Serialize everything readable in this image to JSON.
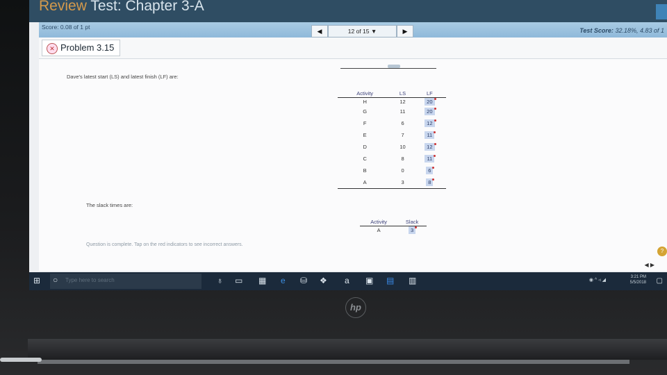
{
  "window": {
    "title_prefix": "Review ",
    "title_rest": "Test: Chapter 3-A"
  },
  "scorebar": {
    "score": "Score: 0.08 of 1 pt",
    "prev_icon": "◀",
    "next_icon": "▶",
    "counter": "12 of 15 ▼",
    "test_score_label": "Test Score:",
    "test_score_value": "32.18%, 4.83 of 1"
  },
  "problem": {
    "title": "Problem 3.15"
  },
  "question": {
    "prompt": "Dave's latest start (LS) and latest finish (LF) are:",
    "table": {
      "headers": [
        "Activity",
        "LS",
        "LF"
      ],
      "rows": [
        {
          "activity": "H",
          "ls": "12",
          "lf": "20"
        },
        {
          "activity": "G",
          "ls": "11",
          "lf": "20"
        },
        {
          "activity": "F",
          "ls": "6",
          "lf": "12"
        },
        {
          "activity": "E",
          "ls": "7",
          "lf": "11"
        },
        {
          "activity": "D",
          "ls": "10",
          "lf": "12"
        },
        {
          "activity": "C",
          "ls": "8",
          "lf": "11"
        },
        {
          "activity": "B",
          "ls": "0",
          "lf": "6"
        },
        {
          "activity": "A",
          "ls": "3",
          "lf": "8"
        }
      ]
    },
    "slack_prompt": "The slack times are:",
    "slack_table": {
      "headers": [
        "Activity",
        "Slack"
      ],
      "rows": [
        {
          "activity": "A",
          "slack": "3"
        }
      ]
    },
    "status": "Question is complete. Tap on the red indicators to see incorrect answers.",
    "help": "?",
    "pager": "◀  ▶"
  },
  "taskbar": {
    "search_placeholder": "Type here to search",
    "time": "3:21 PM",
    "date": "5/5/2018"
  },
  "brand": "hp"
}
